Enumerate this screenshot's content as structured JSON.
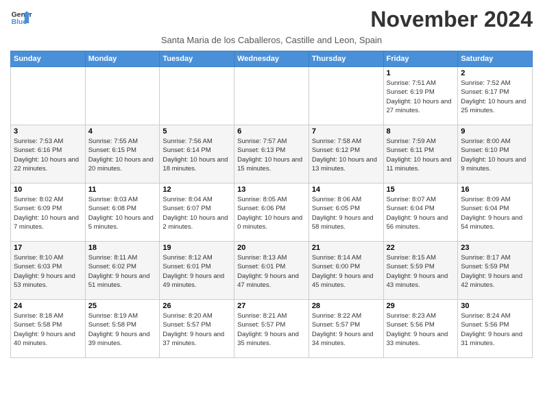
{
  "header": {
    "logo_line1": "General",
    "logo_line2": "Blue",
    "month_title": "November 2024",
    "subtitle": "Santa Maria de los Caballeros, Castille and Leon, Spain"
  },
  "weekdays": [
    "Sunday",
    "Monday",
    "Tuesday",
    "Wednesday",
    "Thursday",
    "Friday",
    "Saturday"
  ],
  "weeks": [
    [
      {
        "day": "",
        "info": ""
      },
      {
        "day": "",
        "info": ""
      },
      {
        "day": "",
        "info": ""
      },
      {
        "day": "",
        "info": ""
      },
      {
        "day": "",
        "info": ""
      },
      {
        "day": "1",
        "info": "Sunrise: 7:51 AM\nSunset: 6:19 PM\nDaylight: 10 hours and 27 minutes."
      },
      {
        "day": "2",
        "info": "Sunrise: 7:52 AM\nSunset: 6:17 PM\nDaylight: 10 hours and 25 minutes."
      }
    ],
    [
      {
        "day": "3",
        "info": "Sunrise: 7:53 AM\nSunset: 6:16 PM\nDaylight: 10 hours and 22 minutes."
      },
      {
        "day": "4",
        "info": "Sunrise: 7:55 AM\nSunset: 6:15 PM\nDaylight: 10 hours and 20 minutes."
      },
      {
        "day": "5",
        "info": "Sunrise: 7:56 AM\nSunset: 6:14 PM\nDaylight: 10 hours and 18 minutes."
      },
      {
        "day": "6",
        "info": "Sunrise: 7:57 AM\nSunset: 6:13 PM\nDaylight: 10 hours and 15 minutes."
      },
      {
        "day": "7",
        "info": "Sunrise: 7:58 AM\nSunset: 6:12 PM\nDaylight: 10 hours and 13 minutes."
      },
      {
        "day": "8",
        "info": "Sunrise: 7:59 AM\nSunset: 6:11 PM\nDaylight: 10 hours and 11 minutes."
      },
      {
        "day": "9",
        "info": "Sunrise: 8:00 AM\nSunset: 6:10 PM\nDaylight: 10 hours and 9 minutes."
      }
    ],
    [
      {
        "day": "10",
        "info": "Sunrise: 8:02 AM\nSunset: 6:09 PM\nDaylight: 10 hours and 7 minutes."
      },
      {
        "day": "11",
        "info": "Sunrise: 8:03 AM\nSunset: 6:08 PM\nDaylight: 10 hours and 5 minutes."
      },
      {
        "day": "12",
        "info": "Sunrise: 8:04 AM\nSunset: 6:07 PM\nDaylight: 10 hours and 2 minutes."
      },
      {
        "day": "13",
        "info": "Sunrise: 8:05 AM\nSunset: 6:06 PM\nDaylight: 10 hours and 0 minutes."
      },
      {
        "day": "14",
        "info": "Sunrise: 8:06 AM\nSunset: 6:05 PM\nDaylight: 9 hours and 58 minutes."
      },
      {
        "day": "15",
        "info": "Sunrise: 8:07 AM\nSunset: 6:04 PM\nDaylight: 9 hours and 56 minutes."
      },
      {
        "day": "16",
        "info": "Sunrise: 8:09 AM\nSunset: 6:04 PM\nDaylight: 9 hours and 54 minutes."
      }
    ],
    [
      {
        "day": "17",
        "info": "Sunrise: 8:10 AM\nSunset: 6:03 PM\nDaylight: 9 hours and 53 minutes."
      },
      {
        "day": "18",
        "info": "Sunrise: 8:11 AM\nSunset: 6:02 PM\nDaylight: 9 hours and 51 minutes."
      },
      {
        "day": "19",
        "info": "Sunrise: 8:12 AM\nSunset: 6:01 PM\nDaylight: 9 hours and 49 minutes."
      },
      {
        "day": "20",
        "info": "Sunrise: 8:13 AM\nSunset: 6:01 PM\nDaylight: 9 hours and 47 minutes."
      },
      {
        "day": "21",
        "info": "Sunrise: 8:14 AM\nSunset: 6:00 PM\nDaylight: 9 hours and 45 minutes."
      },
      {
        "day": "22",
        "info": "Sunrise: 8:15 AM\nSunset: 5:59 PM\nDaylight: 9 hours and 43 minutes."
      },
      {
        "day": "23",
        "info": "Sunrise: 8:17 AM\nSunset: 5:59 PM\nDaylight: 9 hours and 42 minutes."
      }
    ],
    [
      {
        "day": "24",
        "info": "Sunrise: 8:18 AM\nSunset: 5:58 PM\nDaylight: 9 hours and 40 minutes."
      },
      {
        "day": "25",
        "info": "Sunrise: 8:19 AM\nSunset: 5:58 PM\nDaylight: 9 hours and 39 minutes."
      },
      {
        "day": "26",
        "info": "Sunrise: 8:20 AM\nSunset: 5:57 PM\nDaylight: 9 hours and 37 minutes."
      },
      {
        "day": "27",
        "info": "Sunrise: 8:21 AM\nSunset: 5:57 PM\nDaylight: 9 hours and 35 minutes."
      },
      {
        "day": "28",
        "info": "Sunrise: 8:22 AM\nSunset: 5:57 PM\nDaylight: 9 hours and 34 minutes."
      },
      {
        "day": "29",
        "info": "Sunrise: 8:23 AM\nSunset: 5:56 PM\nDaylight: 9 hours and 33 minutes."
      },
      {
        "day": "30",
        "info": "Sunrise: 8:24 AM\nSunset: 5:56 PM\nDaylight: 9 hours and 31 minutes."
      }
    ]
  ]
}
